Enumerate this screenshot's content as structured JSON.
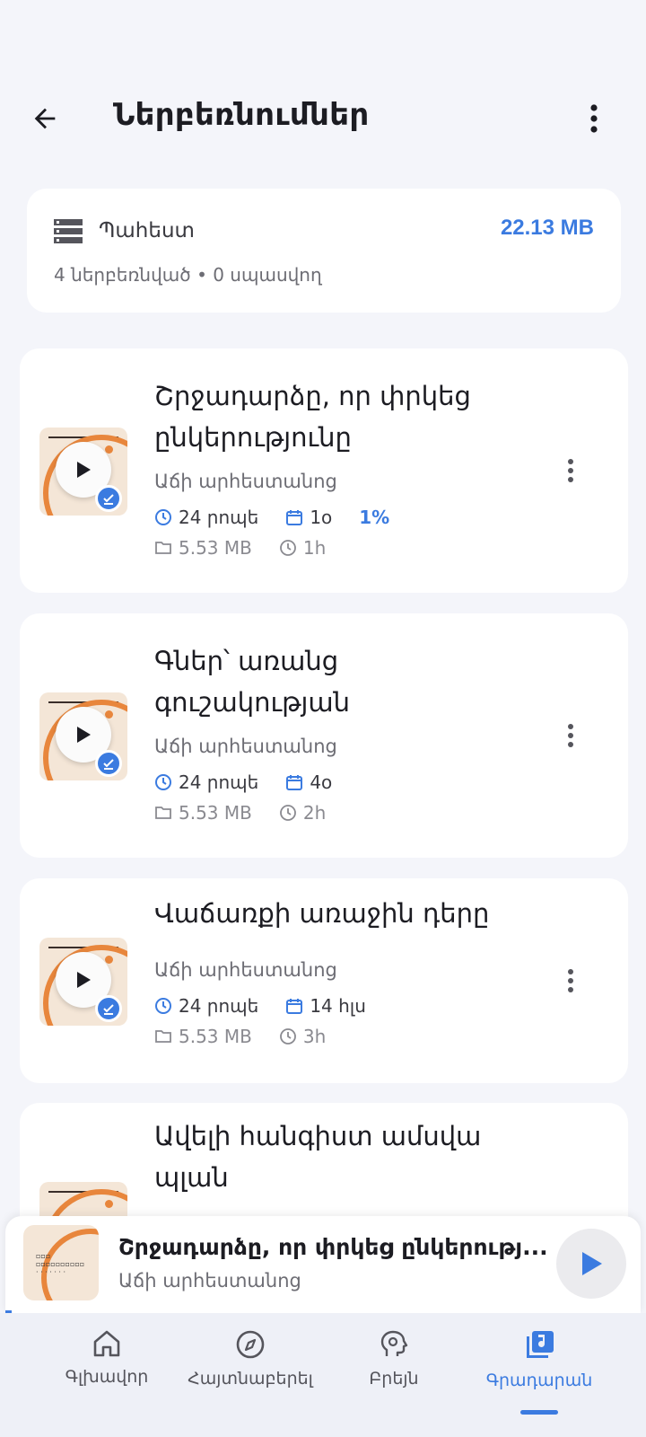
{
  "header": {
    "title": "Ներբեռնումներ",
    "back_icon": "arrow-left-icon",
    "menu_icon": "more-vertical-icon"
  },
  "storage": {
    "icon": "storage-icon",
    "title": "Պահեստ",
    "size": "22.13 MB",
    "summary": "4 ներբեռնված • 0 սպասվող"
  },
  "downloads": [
    {
      "title": "Շրջադարձը, որ փրկեց ընկերությունը",
      "author": "Աճի արհեստանոց",
      "duration": "24 րոպե",
      "date": "1օ",
      "progress": "1%",
      "size": "5.53 MB",
      "time": "1h"
    },
    {
      "title": "Գներ՝ առանց գուշակության",
      "author": "Աճի արհեստանոց",
      "duration": "24 րոպե",
      "date": "4օ",
      "progress": "",
      "size": "5.53 MB",
      "time": "2h"
    },
    {
      "title": "Վաճառքի առաջին դերը",
      "author": "Աճի արհեստանոց",
      "duration": "24 րոպե",
      "date": "14 հլս",
      "progress": "",
      "size": "5.53 MB",
      "time": "3h"
    },
    {
      "title": "Ավելի հանգիստ ամսվա պլան",
      "author": "",
      "duration": "",
      "date": "",
      "progress": "",
      "size": "",
      "time": ""
    }
  ],
  "mini_player": {
    "title": "Շրջադարձը, որ փրկեց ընկերությ...",
    "author": "Աճի արհեստանոց",
    "progress_fraction": 0.01
  },
  "nav": {
    "items": [
      {
        "label": "Գլխավոր",
        "icon": "home-icon"
      },
      {
        "label": "Հայտնաբերել",
        "icon": "compass-icon"
      },
      {
        "label": "Բրեյն",
        "icon": "brain-gear-icon"
      },
      {
        "label": "Գրադարան",
        "icon": "music-library-icon",
        "active": true
      }
    ]
  },
  "colors": {
    "accent": "#3b7be0",
    "background": "#f4f5fa",
    "cover_orange": "#e8863c",
    "cover_bg": "#f4e6d7"
  }
}
